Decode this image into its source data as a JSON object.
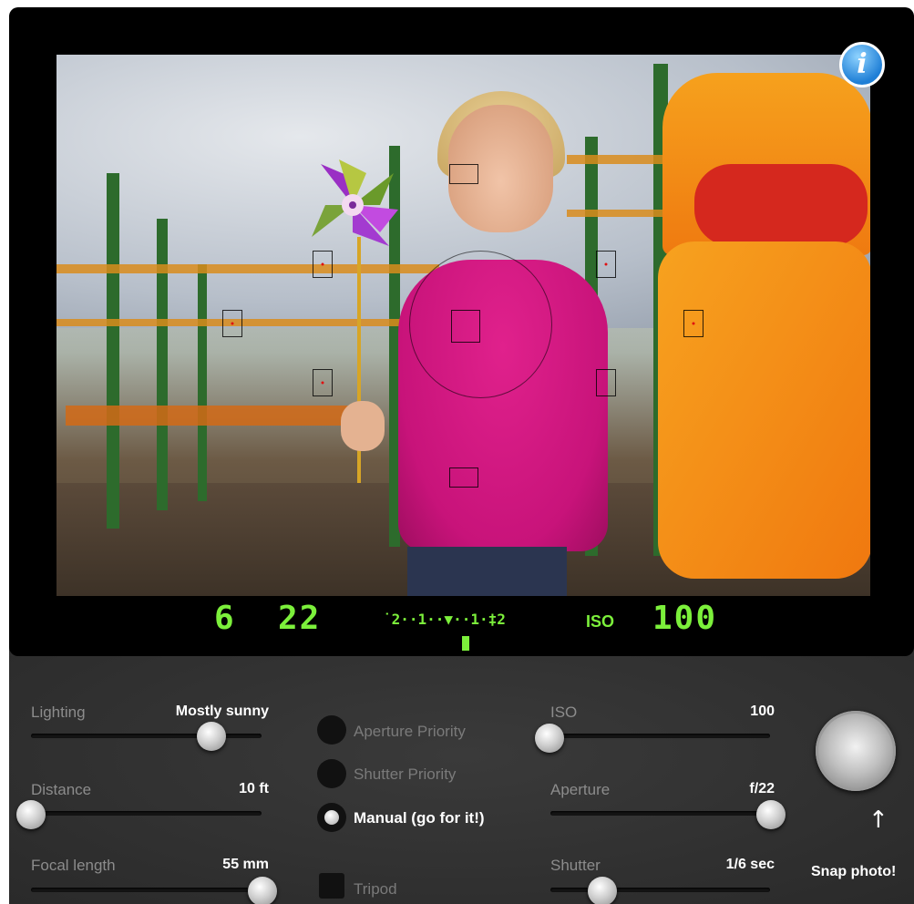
{
  "app": {
    "info_icon": "info-icon",
    "info_glyph": "i"
  },
  "viewfinder": {
    "shutter_display": "6",
    "aperture_display": "22",
    "exposure_scale": "˙2··1··▼··1·‡2",
    "iso_label": "ISO",
    "iso_display": "100",
    "readout_color": "#7cf03b"
  },
  "controls": {
    "lighting": {
      "label": "Lighting",
      "value": "Mostly sunny",
      "level": 0.72
    },
    "distance": {
      "label": "Distance",
      "value": "10 ft",
      "level": 0.0
    },
    "focal_length": {
      "label": "Focal length",
      "value": "55 mm",
      "level": 1.0
    },
    "iso": {
      "label": "ISO",
      "value": "100",
      "level": 0.0
    },
    "aperture": {
      "label": "Aperture",
      "value": "f/22",
      "level": 1.0
    },
    "shutter": {
      "label": "Shutter",
      "value": "1/6 sec",
      "level": 0.23
    }
  },
  "modes": {
    "aperture_priority": "Aperture Priority",
    "shutter_priority": "Shutter Priority",
    "manual": "Manual (go for it!)",
    "selected": "manual"
  },
  "tripod": {
    "label": "Tripod",
    "checked": false
  },
  "snap": {
    "label": "Snap photo!",
    "arrow_glyph": "↑"
  }
}
